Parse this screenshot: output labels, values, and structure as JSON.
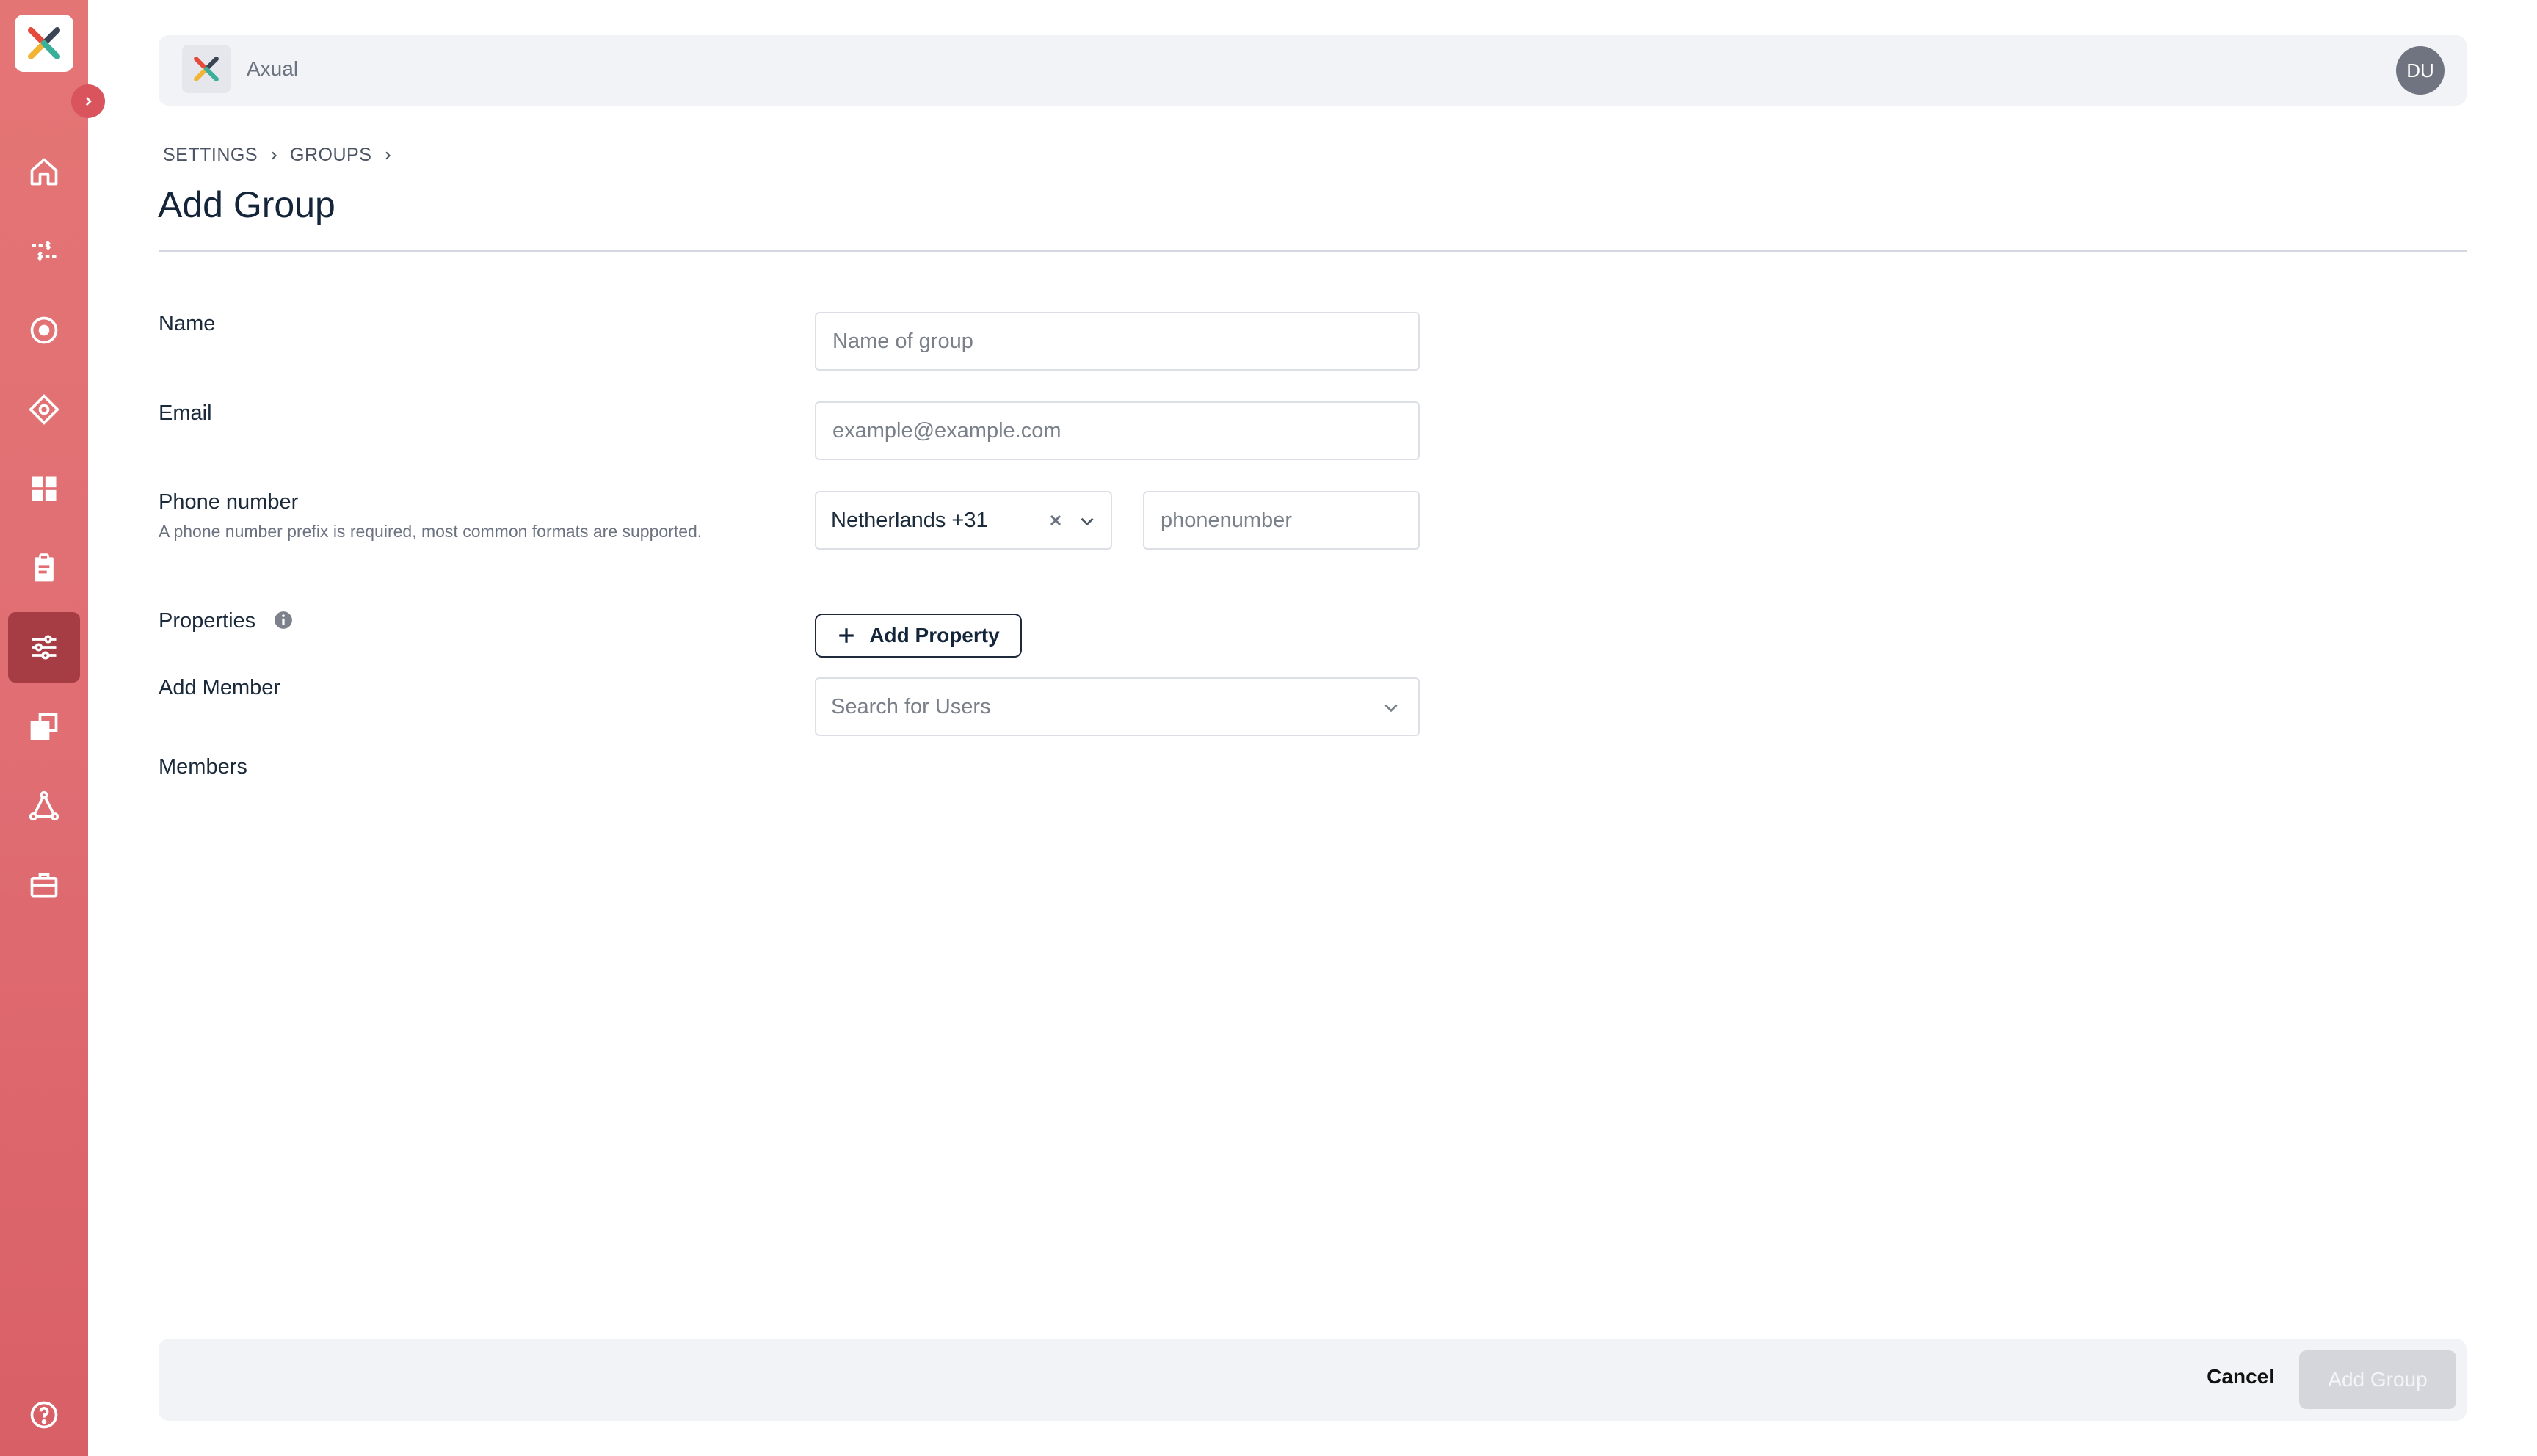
{
  "app": {
    "name": "Axual",
    "user_initials": "DU"
  },
  "breadcrumb": [
    "SETTINGS",
    "GROUPS"
  ],
  "page": {
    "title": "Add Group"
  },
  "form": {
    "name": {
      "label": "Name",
      "placeholder": "Name of group"
    },
    "email": {
      "label": "Email",
      "placeholder": "example@example.com"
    },
    "phone": {
      "label": "Phone number",
      "hint": "A phone number prefix is required, most common formats are supported.",
      "country": "Netherlands +31",
      "placeholder": "phonenumber"
    },
    "properties": {
      "label": "Properties",
      "add_button": "Add Property"
    },
    "add_member": {
      "label": "Add Member",
      "placeholder": "Search for Users"
    },
    "members": {
      "label": "Members"
    }
  },
  "footer": {
    "cancel": "Cancel",
    "submit": "Add Group"
  },
  "nav": [
    "home-icon",
    "streams-icon",
    "applications-icon",
    "schemas-icon",
    "dashboard-icon",
    "clipboard-icon",
    "settings-icon",
    "environments-icon",
    "topology-icon",
    "toolbox-icon",
    "help-icon"
  ],
  "colors": {
    "sidebar": "#e06e73",
    "sidebar_active": "#a63d45",
    "accent": "#d9545c"
  }
}
